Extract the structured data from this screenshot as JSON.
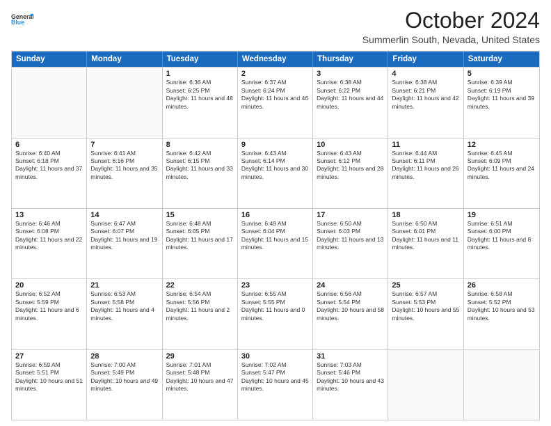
{
  "header": {
    "logo": {
      "line1": "General",
      "line2": "Blue"
    },
    "title": "October 2024",
    "subtitle": "Summerlin South, Nevada, United States"
  },
  "calendar": {
    "days": [
      "Sunday",
      "Monday",
      "Tuesday",
      "Wednesday",
      "Thursday",
      "Friday",
      "Saturday"
    ],
    "weeks": [
      [
        {
          "day": "",
          "sunrise": "",
          "sunset": "",
          "daylight": ""
        },
        {
          "day": "",
          "sunrise": "",
          "sunset": "",
          "daylight": ""
        },
        {
          "day": "1",
          "sunrise": "Sunrise: 6:36 AM",
          "sunset": "Sunset: 6:25 PM",
          "daylight": "Daylight: 11 hours and 48 minutes."
        },
        {
          "day": "2",
          "sunrise": "Sunrise: 6:37 AM",
          "sunset": "Sunset: 6:24 PM",
          "daylight": "Daylight: 11 hours and 46 minutes."
        },
        {
          "day": "3",
          "sunrise": "Sunrise: 6:38 AM",
          "sunset": "Sunset: 6:22 PM",
          "daylight": "Daylight: 11 hours and 44 minutes."
        },
        {
          "day": "4",
          "sunrise": "Sunrise: 6:38 AM",
          "sunset": "Sunset: 6:21 PM",
          "daylight": "Daylight: 11 hours and 42 minutes."
        },
        {
          "day": "5",
          "sunrise": "Sunrise: 6:39 AM",
          "sunset": "Sunset: 6:19 PM",
          "daylight": "Daylight: 11 hours and 39 minutes."
        }
      ],
      [
        {
          "day": "6",
          "sunrise": "Sunrise: 6:40 AM",
          "sunset": "Sunset: 6:18 PM",
          "daylight": "Daylight: 11 hours and 37 minutes."
        },
        {
          "day": "7",
          "sunrise": "Sunrise: 6:41 AM",
          "sunset": "Sunset: 6:16 PM",
          "daylight": "Daylight: 11 hours and 35 minutes."
        },
        {
          "day": "8",
          "sunrise": "Sunrise: 6:42 AM",
          "sunset": "Sunset: 6:15 PM",
          "daylight": "Daylight: 11 hours and 33 minutes."
        },
        {
          "day": "9",
          "sunrise": "Sunrise: 6:43 AM",
          "sunset": "Sunset: 6:14 PM",
          "daylight": "Daylight: 11 hours and 30 minutes."
        },
        {
          "day": "10",
          "sunrise": "Sunrise: 6:43 AM",
          "sunset": "Sunset: 6:12 PM",
          "daylight": "Daylight: 11 hours and 28 minutes."
        },
        {
          "day": "11",
          "sunrise": "Sunrise: 6:44 AM",
          "sunset": "Sunset: 6:11 PM",
          "daylight": "Daylight: 11 hours and 26 minutes."
        },
        {
          "day": "12",
          "sunrise": "Sunrise: 6:45 AM",
          "sunset": "Sunset: 6:09 PM",
          "daylight": "Daylight: 11 hours and 24 minutes."
        }
      ],
      [
        {
          "day": "13",
          "sunrise": "Sunrise: 6:46 AM",
          "sunset": "Sunset: 6:08 PM",
          "daylight": "Daylight: 11 hours and 22 minutes."
        },
        {
          "day": "14",
          "sunrise": "Sunrise: 6:47 AM",
          "sunset": "Sunset: 6:07 PM",
          "daylight": "Daylight: 11 hours and 19 minutes."
        },
        {
          "day": "15",
          "sunrise": "Sunrise: 6:48 AM",
          "sunset": "Sunset: 6:05 PM",
          "daylight": "Daylight: 11 hours and 17 minutes."
        },
        {
          "day": "16",
          "sunrise": "Sunrise: 6:49 AM",
          "sunset": "Sunset: 6:04 PM",
          "daylight": "Daylight: 11 hours and 15 minutes."
        },
        {
          "day": "17",
          "sunrise": "Sunrise: 6:50 AM",
          "sunset": "Sunset: 6:03 PM",
          "daylight": "Daylight: 11 hours and 13 minutes."
        },
        {
          "day": "18",
          "sunrise": "Sunrise: 6:50 AM",
          "sunset": "Sunset: 6:01 PM",
          "daylight": "Daylight: 11 hours and 11 minutes."
        },
        {
          "day": "19",
          "sunrise": "Sunrise: 6:51 AM",
          "sunset": "Sunset: 6:00 PM",
          "daylight": "Daylight: 11 hours and 8 minutes."
        }
      ],
      [
        {
          "day": "20",
          "sunrise": "Sunrise: 6:52 AM",
          "sunset": "Sunset: 5:59 PM",
          "daylight": "Daylight: 11 hours and 6 minutes."
        },
        {
          "day": "21",
          "sunrise": "Sunrise: 6:53 AM",
          "sunset": "Sunset: 5:58 PM",
          "daylight": "Daylight: 11 hours and 4 minutes."
        },
        {
          "day": "22",
          "sunrise": "Sunrise: 6:54 AM",
          "sunset": "Sunset: 5:56 PM",
          "daylight": "Daylight: 11 hours and 2 minutes."
        },
        {
          "day": "23",
          "sunrise": "Sunrise: 6:55 AM",
          "sunset": "Sunset: 5:55 PM",
          "daylight": "Daylight: 11 hours and 0 minutes."
        },
        {
          "day": "24",
          "sunrise": "Sunrise: 6:56 AM",
          "sunset": "Sunset: 5:54 PM",
          "daylight": "Daylight: 10 hours and 58 minutes."
        },
        {
          "day": "25",
          "sunrise": "Sunrise: 6:57 AM",
          "sunset": "Sunset: 5:53 PM",
          "daylight": "Daylight: 10 hours and 55 minutes."
        },
        {
          "day": "26",
          "sunrise": "Sunrise: 6:58 AM",
          "sunset": "Sunset: 5:52 PM",
          "daylight": "Daylight: 10 hours and 53 minutes."
        }
      ],
      [
        {
          "day": "27",
          "sunrise": "Sunrise: 6:59 AM",
          "sunset": "Sunset: 5:51 PM",
          "daylight": "Daylight: 10 hours and 51 minutes."
        },
        {
          "day": "28",
          "sunrise": "Sunrise: 7:00 AM",
          "sunset": "Sunset: 5:49 PM",
          "daylight": "Daylight: 10 hours and 49 minutes."
        },
        {
          "day": "29",
          "sunrise": "Sunrise: 7:01 AM",
          "sunset": "Sunset: 5:48 PM",
          "daylight": "Daylight: 10 hours and 47 minutes."
        },
        {
          "day": "30",
          "sunrise": "Sunrise: 7:02 AM",
          "sunset": "Sunset: 5:47 PM",
          "daylight": "Daylight: 10 hours and 45 minutes."
        },
        {
          "day": "31",
          "sunrise": "Sunrise: 7:03 AM",
          "sunset": "Sunset: 5:46 PM",
          "daylight": "Daylight: 10 hours and 43 minutes."
        },
        {
          "day": "",
          "sunrise": "",
          "sunset": "",
          "daylight": ""
        },
        {
          "day": "",
          "sunrise": "",
          "sunset": "",
          "daylight": ""
        }
      ]
    ]
  }
}
